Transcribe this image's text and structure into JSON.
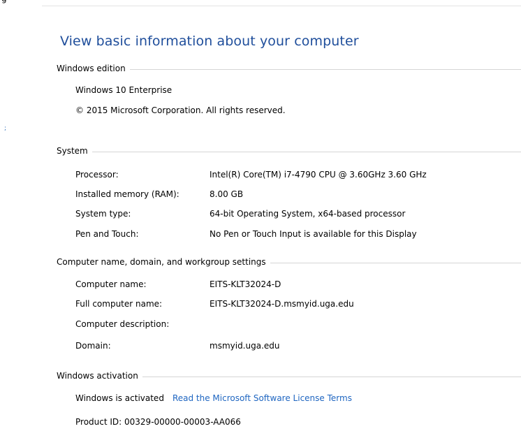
{
  "page": {
    "title": "View basic information about your computer",
    "top_fragment": "g",
    "left_mark": ";"
  },
  "windows_edition": {
    "header": "Windows edition",
    "edition": "Windows 10 Enterprise",
    "copyright": "© 2015 Microsoft Corporation. All rights reserved."
  },
  "system": {
    "header": "System",
    "rows": [
      {
        "label": "Processor:",
        "value": "Intel(R) Core(TM) i7-4790 CPU @ 3.60GHz   3.60 GHz"
      },
      {
        "label": "Installed memory (RAM):",
        "value": "8.00 GB"
      },
      {
        "label": "System type:",
        "value": "64-bit Operating System, x64-based processor"
      },
      {
        "label": "Pen and Touch:",
        "value": "No Pen or Touch Input is available for this Display"
      }
    ]
  },
  "computer_name": {
    "header": "Computer name, domain, and workgroup settings",
    "rows": [
      {
        "label": "Computer name:",
        "value": "EITS-KLT32024-D"
      },
      {
        "label": "Full computer name:",
        "value": "EITS-KLT32024-D.msmyid.uga.edu"
      },
      {
        "label": "Computer description:",
        "value": ""
      },
      {
        "label": "Domain:",
        "value": "msmyid.uga.edu"
      }
    ]
  },
  "activation": {
    "header": "Windows activation",
    "status": "Windows is activated",
    "license_link": "Read the Microsoft Software License Terms",
    "product_id": "Product ID: 00329-00000-00003-AA066"
  },
  "colors": {
    "title": "#1f4e9b",
    "link": "#1f66c1",
    "rule": "#d5d5d5"
  }
}
